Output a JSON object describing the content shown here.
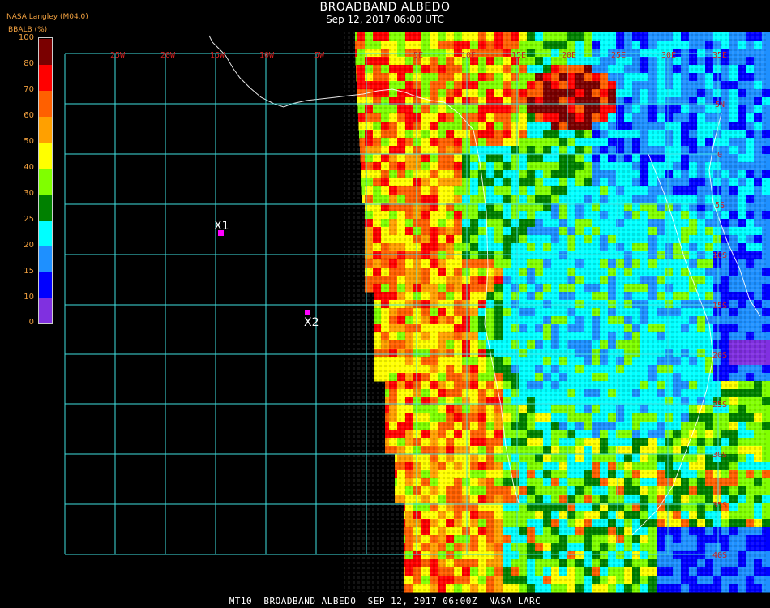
{
  "header": {
    "title": "BROADBAND ALBEDO",
    "subtitle": "Sep 12, 2017 06:00 UTC",
    "producer": "NASA Langley (M04.0)",
    "unit_label": "BBALB (%)"
  },
  "legend": {
    "ticks": [
      "100",
      "80",
      "70",
      "60",
      "50",
      "40",
      "30",
      "25",
      "20",
      "15",
      "10",
      "0"
    ],
    "colors": [
      "#7a0000",
      "#ff0000",
      "#ff6000",
      "#ffa000",
      "#ffff00",
      "#80ff00",
      "#008000",
      "#00ffff",
      "#1e90ff",
      "#0000ff",
      "#8030e0"
    ]
  },
  "grid": {
    "color": "#40e0e0",
    "lon_labels": [
      "25W",
      "20W",
      "15W",
      "10W",
      "5W",
      "",
      "5E",
      "10E",
      "15E",
      "20E",
      "25E",
      "30E",
      "35E"
    ],
    "lat_labels": [
      "5N",
      "0",
      "5S",
      "10S",
      "15S",
      "20S",
      "25S",
      "30S",
      "35S",
      "40S"
    ]
  },
  "markers": [
    {
      "label": "X1",
      "color": "#ff00ff"
    },
    {
      "label": "X2",
      "color": "#ff00ff"
    }
  ],
  "footer": "MT10  BROADBAND ALBEDO  SEP 12, 2017 06:00Z  NASA LARC"
}
